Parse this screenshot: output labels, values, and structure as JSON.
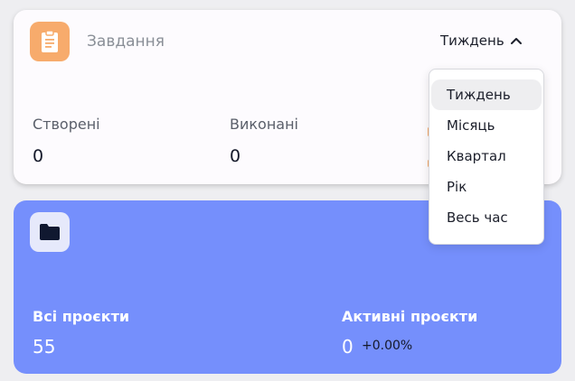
{
  "tasks_card": {
    "title": "Завдання",
    "icon": "clipboard-icon",
    "period_selected": "Тиждень",
    "stats": [
      {
        "label": "Створені",
        "value": "0"
      },
      {
        "label": "Виконані",
        "value": "0"
      }
    ]
  },
  "period_menu": {
    "items": [
      "Тиждень",
      "Місяць",
      "Квартал",
      "Рік",
      "Весь час"
    ],
    "selected_index": 0
  },
  "projects_card": {
    "icon": "folder-icon",
    "all_label": "Всі проєкти",
    "all_value": "55",
    "active_label": "Активні проєкти",
    "active_value": "0",
    "active_change": "+0.00%"
  },
  "colors": {
    "tasks_icon_bg": "#f7ab6c",
    "projects_card_bg": "#758ffc"
  }
}
